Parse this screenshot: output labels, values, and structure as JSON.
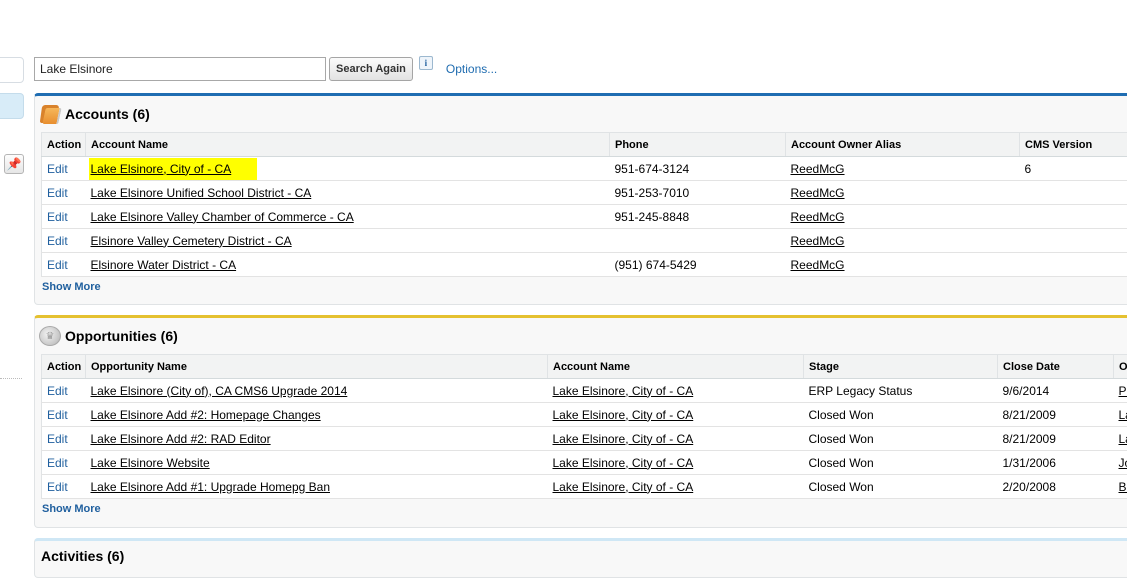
{
  "search": {
    "value": "Lake Elsinore",
    "button_label": "Search Again",
    "info_label": "i",
    "options_label": "Options..."
  },
  "accounts": {
    "title": "Accounts (6)",
    "columns": [
      "Action",
      "Account Name",
      "Phone",
      "Account Owner Alias",
      "CMS Version"
    ],
    "rows": [
      {
        "action": "Edit",
        "name": "Lake Elsinore, City of - CA",
        "phone": "951-674-3124",
        "owner": "ReedMcG",
        "cms": "6",
        "highlighted": true
      },
      {
        "action": "Edit",
        "name": "Lake Elsinore Unified School District - CA",
        "phone": "951-253-7010",
        "owner": "ReedMcG",
        "cms": ""
      },
      {
        "action": "Edit",
        "name": "Lake Elsinore Valley Chamber of Commerce - CA",
        "phone": "951-245-8848",
        "owner": "ReedMcG",
        "cms": ""
      },
      {
        "action": "Edit",
        "name": "Elsinore Valley Cemetery District - CA",
        "phone": "",
        "owner": "ReedMcG",
        "cms": ""
      },
      {
        "action": "Edit",
        "name": "Elsinore Water District - CA",
        "phone": "(951) 674-5429",
        "owner": "ReedMcG",
        "cms": ""
      }
    ],
    "show_more": "Show More"
  },
  "opportunities": {
    "title": "Opportunities (6)",
    "columns": [
      "Action",
      "Opportunity Name",
      "Account Name",
      "Stage",
      "Close Date",
      "Op"
    ],
    "rows": [
      {
        "action": "Edit",
        "name": "Lake Elsinore (City of), CA CMS6 Upgrade 2014",
        "account": "Lake Elsinore, City of - CA",
        "stage": "ERP Legacy Status",
        "close": "9/6/2014",
        "owner": "Pe"
      },
      {
        "action": "Edit",
        "name": "Lake Elsinore Add #2: Homepage Changes",
        "account": "Lake Elsinore, City of - CA",
        "stage": "Closed Won",
        "close": "8/21/2009",
        "owner": "La"
      },
      {
        "action": "Edit",
        "name": "Lake Elsinore Add #2: RAD Editor",
        "account": "Lake Elsinore, City of - CA",
        "stage": "Closed Won",
        "close": "8/21/2009",
        "owner": "La"
      },
      {
        "action": "Edit",
        "name": "Lake Elsinore Website",
        "account": "Lake Elsinore, City of - CA",
        "stage": "Closed Won",
        "close": "1/31/2006",
        "owner": "Jo"
      },
      {
        "action": "Edit",
        "name": "Lake Elsinore Add #1: Upgrade Homepg Ban",
        "account": "Lake Elsinore, City of - CA",
        "stage": "Closed Won",
        "close": "2/20/2008",
        "owner": "Br"
      }
    ],
    "show_more": "Show More"
  },
  "activities": {
    "title": "Activities (6)"
  }
}
